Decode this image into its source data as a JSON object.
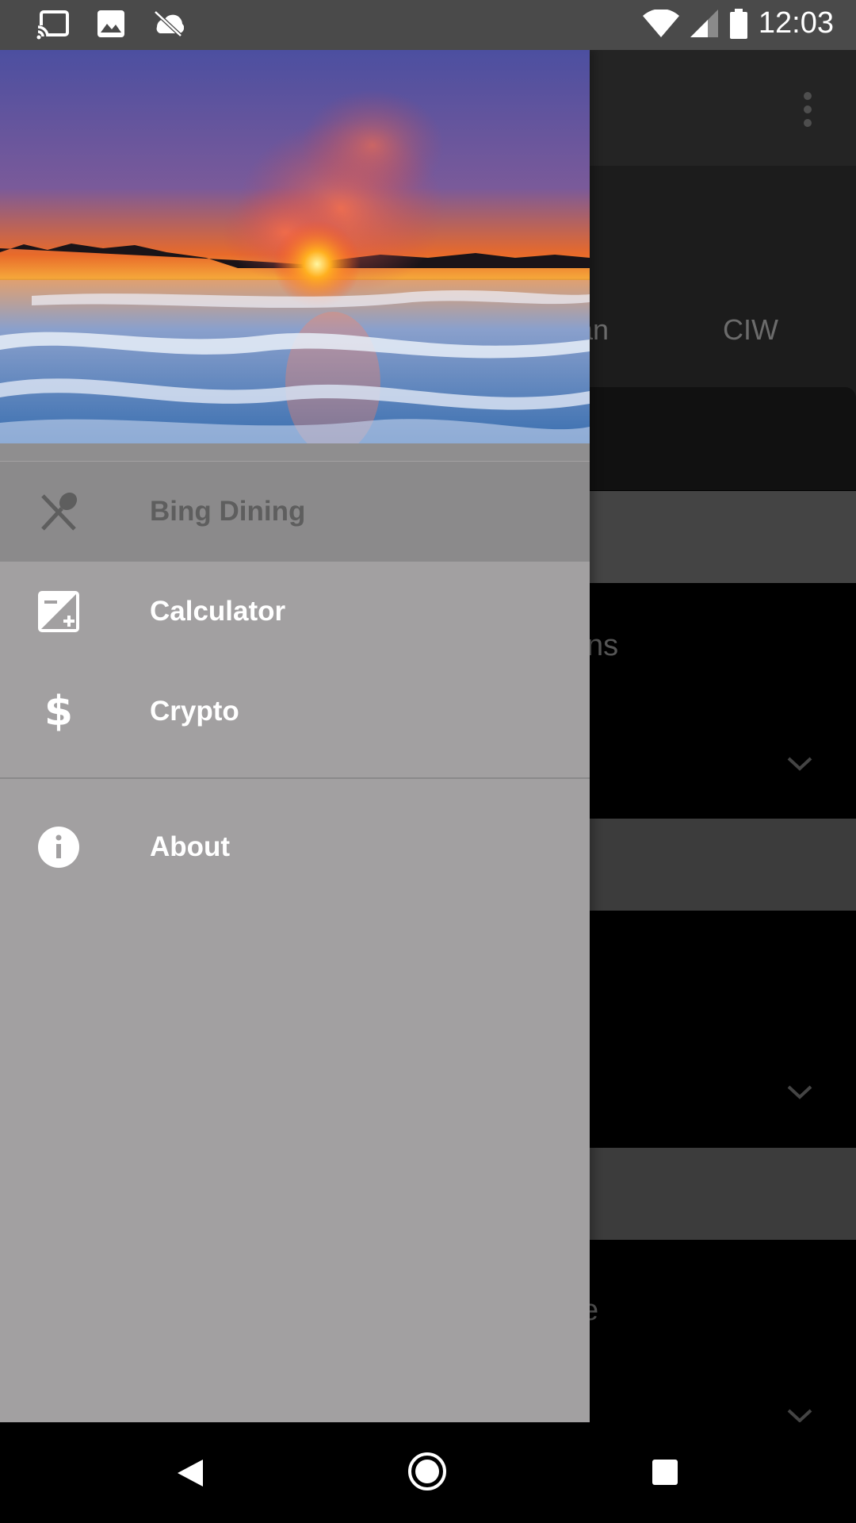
{
  "status_bar": {
    "time": "12:03",
    "icons_left": [
      "cast-icon",
      "image-icon",
      "sync-off-icon"
    ],
    "icons_right": [
      "wifi-icon",
      "signal-icon",
      "battery-icon"
    ]
  },
  "background_app": {
    "tabs": [
      "an",
      "CIW"
    ],
    "fragments": [
      "ns",
      "e"
    ]
  },
  "drawer": {
    "header_image": "geyser-sunset",
    "items": [
      {
        "label": "Bing Dining",
        "icon": "dining-icon",
        "active": true
      },
      {
        "label": "Calculator",
        "icon": "calculator-icon",
        "active": false
      },
      {
        "label": "Crypto",
        "icon": "dollar-icon",
        "active": false
      }
    ],
    "secondary_items": [
      {
        "label": "About",
        "icon": "info-icon"
      }
    ]
  },
  "navigation_bar": {
    "buttons": [
      "back-button",
      "home-button",
      "recents-button"
    ]
  },
  "colors": {
    "drawer_bg": "#a2a0a1",
    "active_item_bg": "#8b8a8b",
    "status_bar": "#4a4a4a"
  }
}
